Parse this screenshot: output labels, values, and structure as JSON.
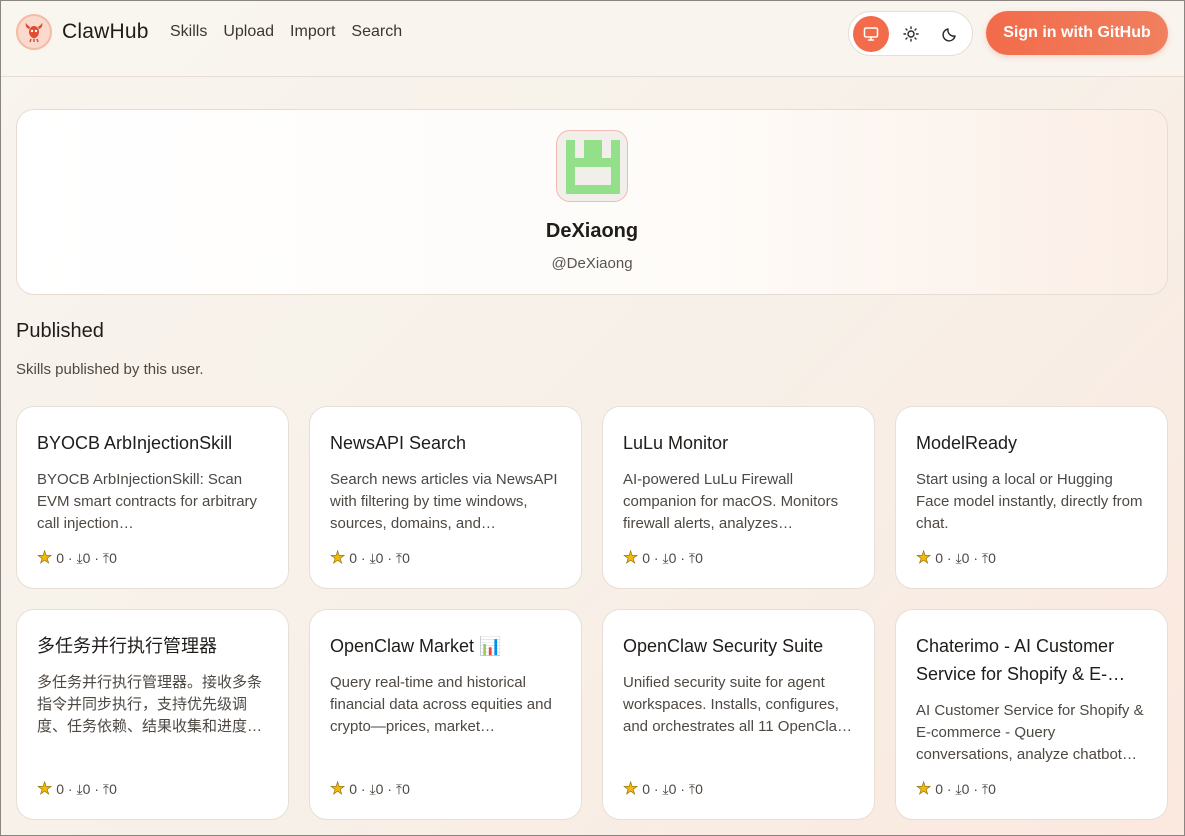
{
  "header": {
    "brand": "ClawHub",
    "nav": [
      "Skills",
      "Upload",
      "Import",
      "Search"
    ],
    "theme_modes": [
      "monitor-icon",
      "sun-icon",
      "moon-icon"
    ],
    "active_theme": "monitor",
    "signin_label": "Sign in  with GitHub"
  },
  "profile": {
    "display_name": "DeXiaong",
    "handle": "@DeXiaong"
  },
  "section": {
    "title": "Published",
    "subtitle": "Skills published by this user."
  },
  "skills": [
    {
      "title": "BYOCB ArbInjectionSkill",
      "description": "BYOCB ArbInjectionSkill: Scan EVM smart contracts for arbitrary call injection…",
      "stats": "0 · ⤓0 · ⤒0"
    },
    {
      "title": "NewsAPI Search",
      "description": "Search news articles via NewsAPI with filtering by time windows, sources, domains, and…",
      "stats": "0 · ⤓0 · ⤒0"
    },
    {
      "title": "LuLu Monitor",
      "description": "AI-powered LuLu Firewall companion for macOS. Monitors firewall alerts, analyzes…",
      "stats": "0 · ⤓0 · ⤒0"
    },
    {
      "title": "ModelReady",
      "description": "Start using a local or Hugging Face model instantly, directly from chat.",
      "stats": "0 · ⤓0 · ⤒0"
    },
    {
      "title": "多任务并行执行管理器",
      "description": "多任务并行执行管理器。接收多条指令并同步执行，支持优先级调度、任务依赖、结果收集和进度…",
      "stats": "0 · ⤓0 · ⤒0"
    },
    {
      "title": "OpenClaw Market 📊",
      "description": "Query real-time and historical financial data across equities and crypto—prices, market…",
      "stats": "0 · ⤓0 · ⤒0"
    },
    {
      "title": "OpenClaw Security Suite",
      "description": "Unified security suite for agent workspaces. Installs, configures, and orchestrates all 11 OpenCla…",
      "stats": "0 · ⤓0 · ⤒0"
    },
    {
      "title": "Chaterimo - AI Customer Service for Shopify & E-commerce",
      "description": "AI Customer Service for Shopify & E-commerce - Query conversations, analyze chatbot…",
      "stats": "0 · ⤓0 · ⤒0"
    }
  ],
  "colors": {
    "accent": "#f26b4a",
    "avatar_pattern": "#94e08a",
    "star": "#f2b90d"
  }
}
